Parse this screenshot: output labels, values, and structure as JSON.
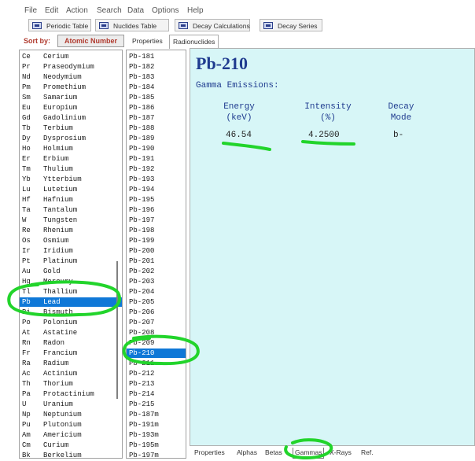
{
  "menu": [
    "File",
    "Edit",
    "Action",
    "Search",
    "Data",
    "Options",
    "Help"
  ],
  "toolbar": [
    "Periodic Table",
    "Nuclides Table",
    "Decay Calculations",
    "Decay Series"
  ],
  "sort": {
    "label": "Sort by:",
    "button": "Atomic Number"
  },
  "top_tabs": [
    "Properties",
    "Radionuclides"
  ],
  "elements": [
    {
      "sym": "Ce",
      "name": "Cerium"
    },
    {
      "sym": "Pr",
      "name": "Praseodymium"
    },
    {
      "sym": "Nd",
      "name": "Neodymium"
    },
    {
      "sym": "Pm",
      "name": "Promethium"
    },
    {
      "sym": "Sm",
      "name": "Samarium"
    },
    {
      "sym": "Eu",
      "name": "Europium"
    },
    {
      "sym": "Gd",
      "name": "Gadolinium"
    },
    {
      "sym": "Tb",
      "name": "Terbium"
    },
    {
      "sym": "Dy",
      "name": "Dysprosium"
    },
    {
      "sym": "Ho",
      "name": "Holmium"
    },
    {
      "sym": "Er",
      "name": "Erbium"
    },
    {
      "sym": "Tm",
      "name": "Thulium"
    },
    {
      "sym": "Yb",
      "name": "Ytterbium"
    },
    {
      "sym": "Lu",
      "name": "Lutetium"
    },
    {
      "sym": "Hf",
      "name": "Hafnium"
    },
    {
      "sym": "Ta",
      "name": "Tantalum"
    },
    {
      "sym": "W",
      "name": "Tungsten"
    },
    {
      "sym": "Re",
      "name": "Rhenium"
    },
    {
      "sym": "Os",
      "name": "Osmium"
    },
    {
      "sym": "Ir",
      "name": "Iridium"
    },
    {
      "sym": "Pt",
      "name": "Platinum"
    },
    {
      "sym": "Au",
      "name": "Gold"
    },
    {
      "sym": "Hg",
      "name": "Mercury"
    },
    {
      "sym": "Tl",
      "name": "Thallium"
    },
    {
      "sym": "Pb",
      "name": "Lead",
      "selected": true
    },
    {
      "sym": "Bi",
      "name": "Bismuth"
    },
    {
      "sym": "Po",
      "name": "Polonium"
    },
    {
      "sym": "At",
      "name": "Astatine"
    },
    {
      "sym": "Rn",
      "name": "Radon"
    },
    {
      "sym": "Fr",
      "name": "Francium"
    },
    {
      "sym": "Ra",
      "name": "Radium"
    },
    {
      "sym": "Ac",
      "name": "Actinium"
    },
    {
      "sym": "Th",
      "name": "Thorium"
    },
    {
      "sym": "Pa",
      "name": "Protactinium"
    },
    {
      "sym": "U",
      "name": "Uranium"
    },
    {
      "sym": "Np",
      "name": "Neptunium"
    },
    {
      "sym": "Pu",
      "name": "Plutonium"
    },
    {
      "sym": "Am",
      "name": "Americium"
    },
    {
      "sym": "Cm",
      "name": "Curium"
    },
    {
      "sym": "Bk",
      "name": "Berkelium"
    }
  ],
  "nuclides": [
    {
      "name": "Pb-181"
    },
    {
      "name": "Pb-182"
    },
    {
      "name": "Pb-183"
    },
    {
      "name": "Pb-184"
    },
    {
      "name": "Pb-185"
    },
    {
      "name": "Pb-186"
    },
    {
      "name": "Pb-187"
    },
    {
      "name": "Pb-188"
    },
    {
      "name": "Pb-189"
    },
    {
      "name": "Pb-190"
    },
    {
      "name": "Pb-191"
    },
    {
      "name": "Pb-192"
    },
    {
      "name": "Pb-193"
    },
    {
      "name": "Pb-194"
    },
    {
      "name": "Pb-195"
    },
    {
      "name": "Pb-196"
    },
    {
      "name": "Pb-197"
    },
    {
      "name": "Pb-198"
    },
    {
      "name": "Pb-199"
    },
    {
      "name": "Pb-200"
    },
    {
      "name": "Pb-201"
    },
    {
      "name": "Pb-202"
    },
    {
      "name": "Pb-203"
    },
    {
      "name": "Pb-204"
    },
    {
      "name": "Pb-205"
    },
    {
      "name": "Pb-206"
    },
    {
      "name": "Pb-207"
    },
    {
      "name": "Pb-208"
    },
    {
      "name": "Pb-209"
    },
    {
      "name": "Pb-210",
      "selected": true
    },
    {
      "name": "Pb-211"
    },
    {
      "name": "Pb-212"
    },
    {
      "name": "Pb-213"
    },
    {
      "name": "Pb-214"
    },
    {
      "name": "Pb-215"
    },
    {
      "name": "Pb-187m"
    },
    {
      "name": "Pb-191m"
    },
    {
      "name": "Pb-193m"
    },
    {
      "name": "Pb-195m"
    },
    {
      "name": "Pb-197m"
    }
  ],
  "detail": {
    "title": "Pb-210",
    "subtitle": "Gamma Emissions:",
    "columns": [
      {
        "label": "Energy",
        "unit": "(keV)"
      },
      {
        "label": "Intensity",
        "unit": "(%)"
      },
      {
        "label": "Decay",
        "unit": "Mode"
      }
    ],
    "row": {
      "energy": "46.54",
      "intensity": "4.2500",
      "mode": "b-"
    }
  },
  "bottom_tabs": [
    {
      "label": "Properties"
    },
    {
      "label": "Alphas"
    },
    {
      "label": "Betas"
    },
    {
      "label": "Gammas",
      "active": true
    },
    {
      "label": "X-Rays"
    },
    {
      "label": "Ref."
    }
  ],
  "colors": {
    "selection": "#0f78d7",
    "panel": "#d7f6f7",
    "heading": "#1f3b8f",
    "highlight": "#22d42b",
    "sort": "#b03a2e"
  }
}
